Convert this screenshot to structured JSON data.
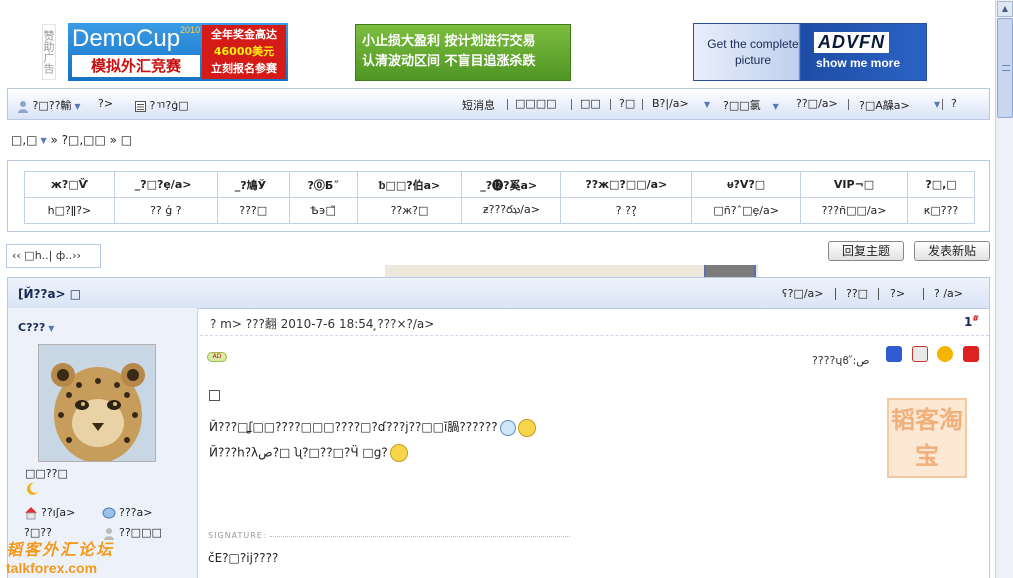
{
  "ads": {
    "label": "赞助广告",
    "ad1": {
      "title": "DemoCup",
      "year": "2010",
      "cn_title": "模拟外汇竞赛",
      "prize_line1": "全年奖金高达",
      "prize_amount": "46000美元",
      "prize_line3": "立刻报名参赛"
    },
    "ad2": {
      "line1": "小止损大盈利  按计划进行交易",
      "line2": "认清波动区间  不盲目追涨杀跌"
    },
    "ad3": {
      "line1": "Get the complete",
      "line2": "picture",
      "brand": "ADVFN",
      "cta": "show me more"
    }
  },
  "navbar": {
    "user_menu": "?□??輸",
    "item2": "?>",
    "item3": "?ㄲ?ģ□",
    "short_msg": "短消息",
    "item_box": "□□□□",
    "item_a": "□□",
    "item_b": "?□",
    "item_c": "B?|/a>",
    "item_d": "?□□氯",
    "item_e": "??□/a>",
    "item_f": "?□A髞a>",
    "item_g": "?"
  },
  "breadcrumb": {
    "home": "□,□",
    "path": "» ?□,□□ » □"
  },
  "forum_table": {
    "rows": [
      [
        "ж?□Ѷ",
        "̲?□?ȩ/a>",
        "̲?鳩Ў",
        "?⓪Ƃ˝",
        "ᵬ□□?伯a>",
        "̲?⓬?奚a>",
        "??ж□?□□/a>",
        "ᵾ?V?□",
        "VIP¬□",
        "?□,□"
      ],
      [
        "h□?ǁ?>",
        "?? ǵ ?",
        "???□",
        "Ѣ϶□̃",
        "??ж?□",
        "ƶ???ఝ/a>",
        "?   ??̧",
        "□ñ?ˆ□ȩ/a>",
        "???ñ□□/a>",
        "ԟ□???"
      ]
    ]
  },
  "pager": "‹‹ □h..| ф..››",
  "buttons": {
    "reply": "回复主题",
    "new_post": "发表新贴"
  },
  "thread": {
    "title": "[Й??a> □",
    "r1": "ʕ?□/a>",
    "r2": "??□",
    "r3": "?>",
    "r4": "?  /a>"
  },
  "post": {
    "username": "C???",
    "status": "□□??□",
    "link1": "??ıʃa>",
    "link2": "???a>",
    "link3": "?□??",
    "link4": "??□□□",
    "meta": "?   m> ???翿 2010-7-6 18:54   ̧???×?/a>",
    "floor": "1",
    "floor_sup": "#",
    "ad_badge": "AD",
    "share": "????ɥϐ ̋:ص",
    "line1": "Й???□ʆ□□????□□□????□?ɗ???j??□□ĭ腡??????",
    "line2": "Й???h?λص?□   ʯ?□??□?Ӵ    □g?",
    "stamp": "韬客淘宝",
    "signature_label": "SIGNATURE:",
    "signature": "čЕ?□?ij????"
  },
  "watermark": {
    "cn": "韬客外汇论坛",
    "en": "talkforex.com"
  },
  "colors": {
    "accent": "#1a2a55",
    "nav_bg": "#e7eefa",
    "border": "#b9c8e3",
    "side_bg": "#edf2fa"
  }
}
